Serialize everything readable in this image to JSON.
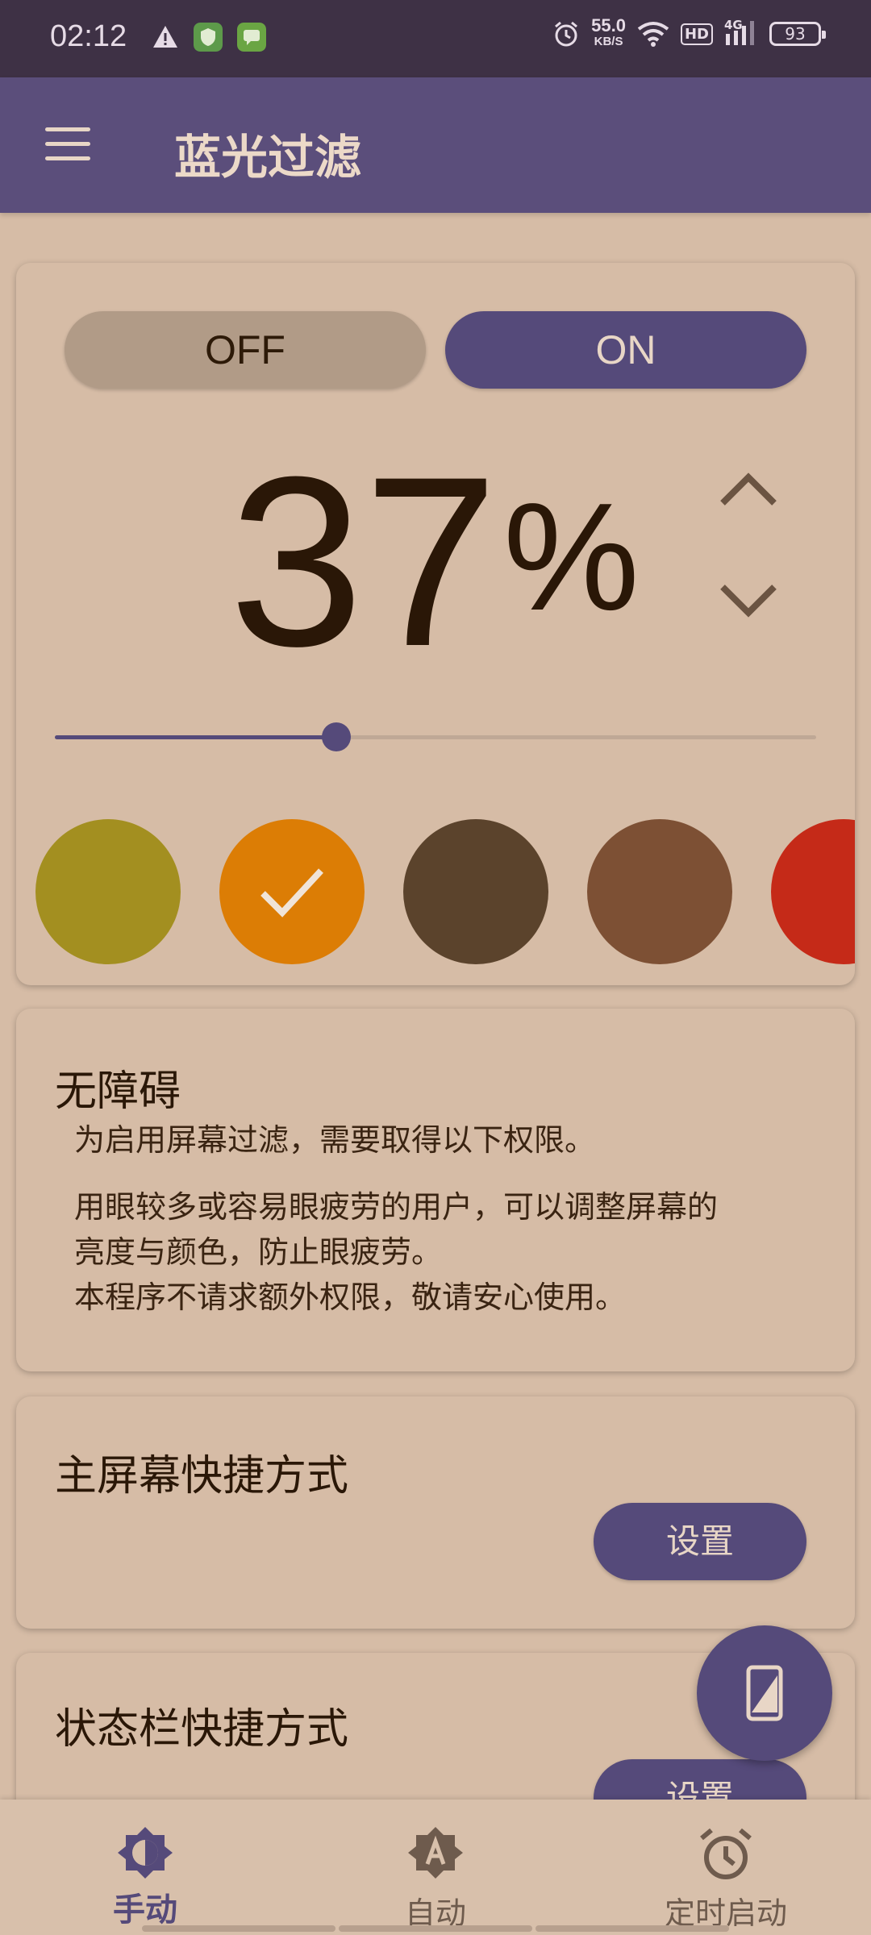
{
  "status_bar": {
    "time": "02:12",
    "net_speed": "55.0",
    "net_unit": "KB/S",
    "hd": "HD",
    "signal": "4G",
    "battery": "93",
    "icons": [
      "warning-icon",
      "app-shield-icon",
      "app-message-icon",
      "alarm-icon",
      "wifi-icon",
      "signal-icon",
      "battery-icon"
    ]
  },
  "app_bar": {
    "title": "蓝光过滤",
    "menu_icon": "hamburger-menu-icon"
  },
  "filter_card": {
    "off_label": "OFF",
    "on_label": "ON",
    "state": "ON",
    "intensity": "37",
    "percent_sign": "%",
    "slider_value": 0.37,
    "colors": [
      {
        "name": "olive",
        "hex": "#a38f20",
        "selected": false
      },
      {
        "name": "orange",
        "hex": "#dc7d05",
        "selected": true
      },
      {
        "name": "dark-brown",
        "hex": "#5b432c",
        "selected": false
      },
      {
        "name": "brown",
        "hex": "#7d5034",
        "selected": false
      },
      {
        "name": "red",
        "hex": "#c52a18",
        "selected": false
      }
    ]
  },
  "accessibility_card": {
    "title": "无障碍",
    "subtitle": "为启用屏幕过滤，需要取得以下权限。",
    "body_line1": "用眼较多或容易眼疲劳的用户，可以调整屏幕的",
    "body_line2": "亮度与颜色，防止眼疲劳。",
    "body_line3": "本程序不请求额外权限，敬请安心使用。"
  },
  "home_shortcut_card": {
    "title": "主屏幕快捷方式",
    "button_label": "设置"
  },
  "statusbar_shortcut_card": {
    "title": "状态栏快捷方式",
    "button_label": "设置"
  },
  "fab": {
    "icon": "phone-screen-icon"
  },
  "bottom_nav": {
    "items": [
      {
        "label": "手动",
        "icon": "brightness-icon",
        "active": true
      },
      {
        "label": "自动",
        "icon": "auto-brightness-icon",
        "active": false
      },
      {
        "label": "定时启动",
        "icon": "alarm-clock-icon",
        "active": false
      }
    ]
  },
  "colors": {
    "background": "#d6bca6",
    "primary": "#554a7a",
    "app_bar": "#5b4e7b",
    "status_bar": "#3e3145"
  }
}
